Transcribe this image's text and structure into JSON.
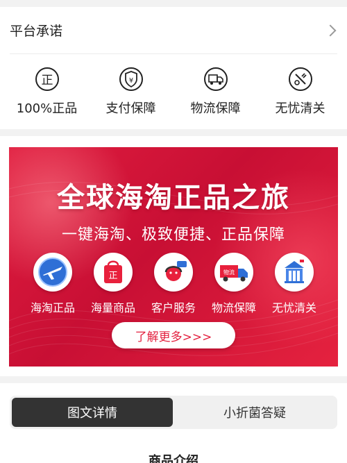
{
  "promise": {
    "title": "平台承诺",
    "features": [
      {
        "label": "100%正品",
        "icon": "genuine-icon"
      },
      {
        "label": "支付保障",
        "icon": "payment-shield-icon"
      },
      {
        "label": "物流保障",
        "icon": "delivery-truck-icon"
      },
      {
        "label": "无忧清关",
        "icon": "customs-clearance-icon"
      }
    ]
  },
  "feature_icon_text": {
    "genuine": "正",
    "yen": "¥"
  },
  "banner": {
    "title": "全球海淘正品之旅",
    "subtitle": "一键海淘、极致便捷、正品保障",
    "services": [
      {
        "label": "海淘正品",
        "icon": "airplane-icon"
      },
      {
        "label": "海量商品",
        "icon": "shopping-bag-icon"
      },
      {
        "label": "客户服务",
        "icon": "customer-service-icon"
      },
      {
        "label": "物流保障",
        "icon": "logistics-truck-icon"
      },
      {
        "label": "无忧清关",
        "icon": "customs-building-icon"
      }
    ],
    "truck_text": "物流",
    "bag_text": "正",
    "button": "了解更多>>>",
    "colors": {
      "accent": "#e3213f"
    }
  },
  "tabs": [
    {
      "label": "图文详情",
      "active": true
    },
    {
      "label": "小折菌答疑",
      "active": false
    }
  ],
  "section_title": "商品介绍"
}
